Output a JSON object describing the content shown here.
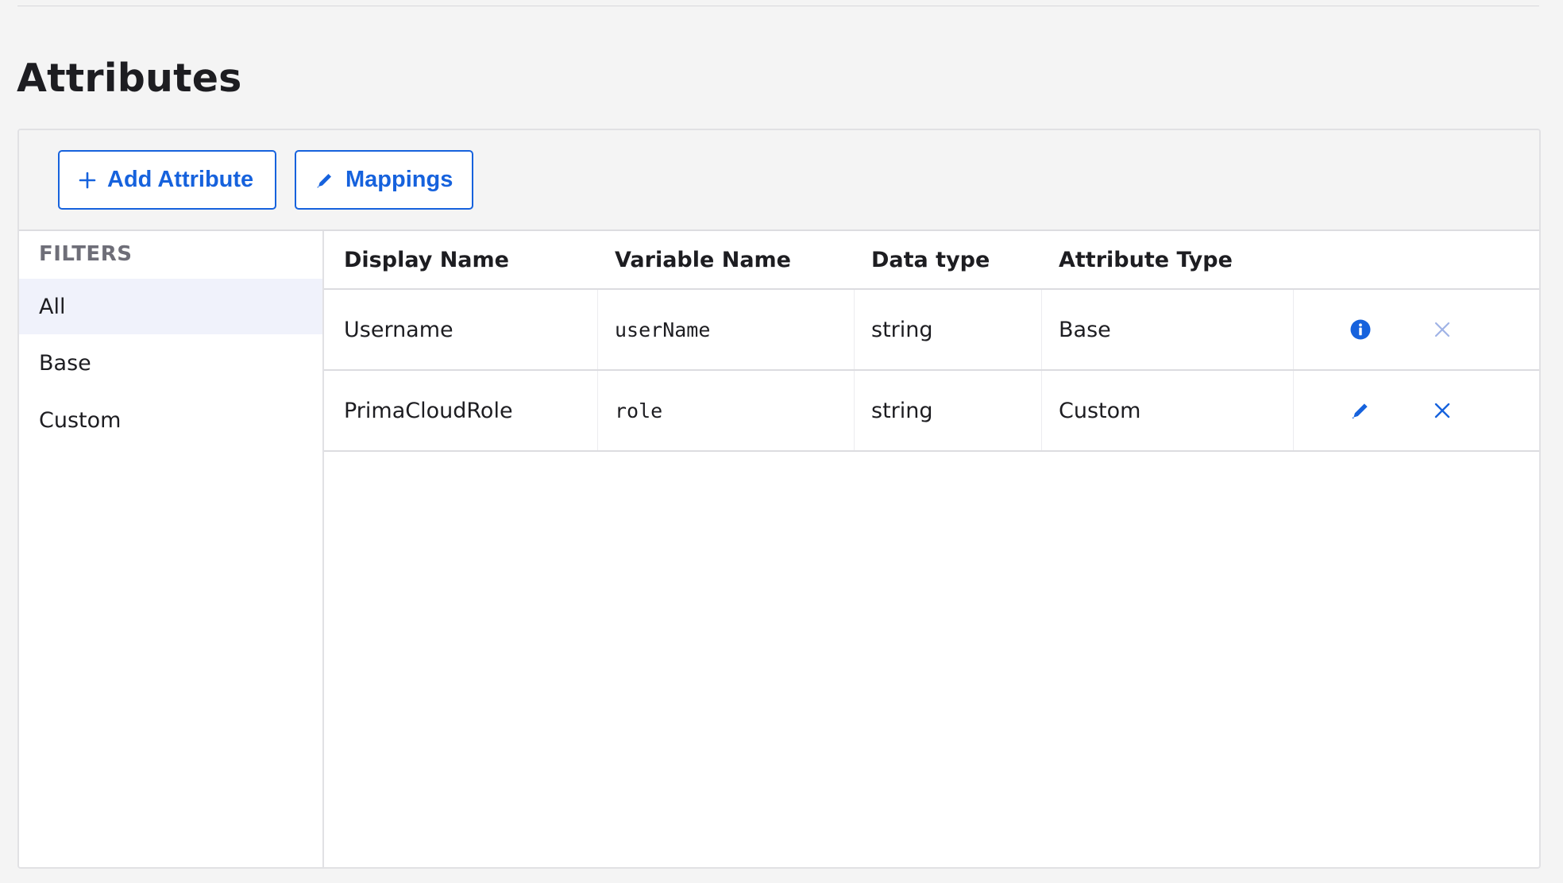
{
  "page": {
    "title": "Attributes"
  },
  "toolbar": {
    "add_label": "Add Attribute",
    "mappings_label": "Mappings"
  },
  "filters": {
    "heading": "FILTERS",
    "items": [
      {
        "label": "All",
        "active": true
      },
      {
        "label": "Base",
        "active": false
      },
      {
        "label": "Custom",
        "active": false
      }
    ]
  },
  "table": {
    "columns": [
      "Display Name",
      "Variable Name",
      "Data type",
      "Attribute Type"
    ],
    "rows": [
      {
        "display_name": "Username",
        "variable_name": "userName",
        "data_type": "string",
        "attribute_type": "Base",
        "action_icons": [
          "info-icon",
          "remove-icon-disabled"
        ]
      },
      {
        "display_name": "PrimaCloudRole",
        "variable_name": "role",
        "data_type": "string",
        "attribute_type": "Custom",
        "action_icons": [
          "edit-icon",
          "remove-icon"
        ]
      }
    ]
  },
  "colors": {
    "accent": "#1662dd",
    "accent_disabled": "#9fb3e6",
    "background": "#f4f4f4",
    "text": "#1d1d21",
    "muted": "#6e6e78",
    "active_filter_bg": "#f0f2fb"
  }
}
